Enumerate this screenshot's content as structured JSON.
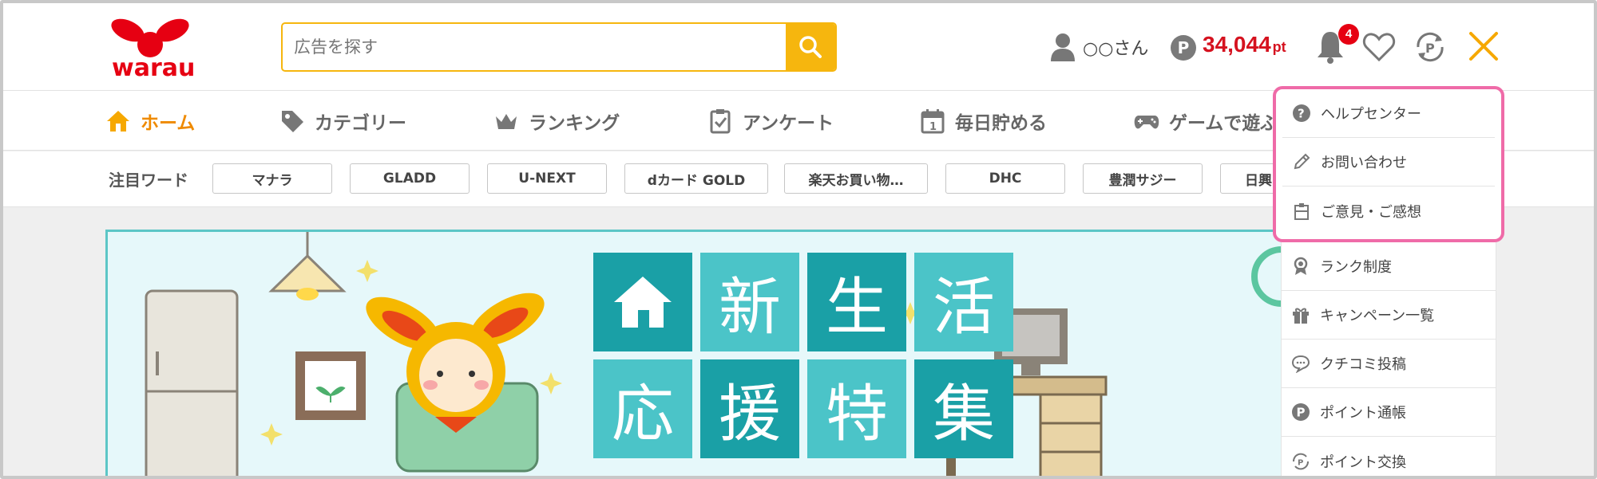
{
  "header": {
    "logo_text": "warau",
    "search_placeholder": "広告を探す",
    "user_name": "○○さん",
    "point_badge": "P",
    "points": "34,044",
    "points_unit": "pt",
    "notification_count": "4"
  },
  "nav": {
    "items": [
      {
        "label": "ホーム",
        "icon": "home-icon"
      },
      {
        "label": "カテゴリー",
        "icon": "tag-icon"
      },
      {
        "label": "ランキング",
        "icon": "crown-icon"
      },
      {
        "label": "アンケート",
        "icon": "clipboard-check-icon"
      },
      {
        "label": "毎日貯める",
        "icon": "calendar-icon"
      },
      {
        "label": "ゲームで遊ぶ",
        "icon": "gamepad-icon"
      }
    ]
  },
  "words": {
    "label": "注目ワード",
    "chips": [
      "マナラ",
      "GLADD",
      "U-NEXT",
      "dカード GOLD",
      "楽天お買い物…",
      "DHC",
      "豊潤サジー",
      "日興"
    ]
  },
  "banner": {
    "tiles_row1": [
      "新",
      "生",
      "活"
    ],
    "tiles_row2": [
      "応",
      "援",
      "特",
      "集"
    ]
  },
  "menu": {
    "highlighted": [
      {
        "label": "ヘルプセンター",
        "icon": "help-circle-icon"
      },
      {
        "label": "お問い合わせ",
        "icon": "pencil-icon"
      },
      {
        "label": "ご意見・ご感想",
        "icon": "clipboard-icon"
      }
    ],
    "items": [
      {
        "label": "ランク制度",
        "icon": "medal-icon"
      },
      {
        "label": "キャンペーン一覧",
        "icon": "gift-icon"
      },
      {
        "label": "クチコミ投稿",
        "icon": "speech-bubble-icon"
      },
      {
        "label": "ポイント通帳",
        "icon": "point-circle-icon"
      },
      {
        "label": "ポイント交換",
        "icon": "point-exchange-icon"
      }
    ]
  },
  "colors": {
    "accent": "#f6b60e",
    "points": "#d5121f",
    "highlight_border": "#ef6ba8",
    "active_nav": "#ef8a00"
  }
}
